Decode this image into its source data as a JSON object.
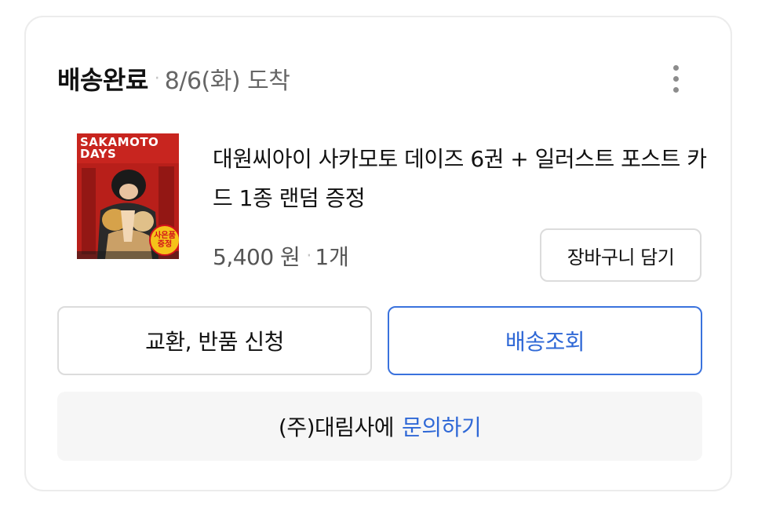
{
  "order": {
    "status": "배송완료",
    "separator": "·",
    "arrival": "8/6(화) 도착",
    "more_icon": "more-vertical-icon"
  },
  "product": {
    "cover_title_line1": "SAKAMOTO",
    "cover_title_line2": "DAYS",
    "cover_badge_line1": "사은품",
    "cover_badge_line2": "증정",
    "title": "대원씨아이 사카모토 데이즈 6권 + 일러스트 포스트 카드 1종 랜덤 증정",
    "price": "5,400 원",
    "separator": "·",
    "quantity": "1개",
    "cart_label": "장바구니 담기"
  },
  "actions": {
    "return_label": "교환, 반품 신청",
    "track_label": "배송조회"
  },
  "inquiry": {
    "company": "(주)대림사에",
    "link_label": "문의하기"
  },
  "colors": {
    "accent": "#2f68d6",
    "cover_red": "#c8251f",
    "badge_yellow": "#f5c21a"
  }
}
